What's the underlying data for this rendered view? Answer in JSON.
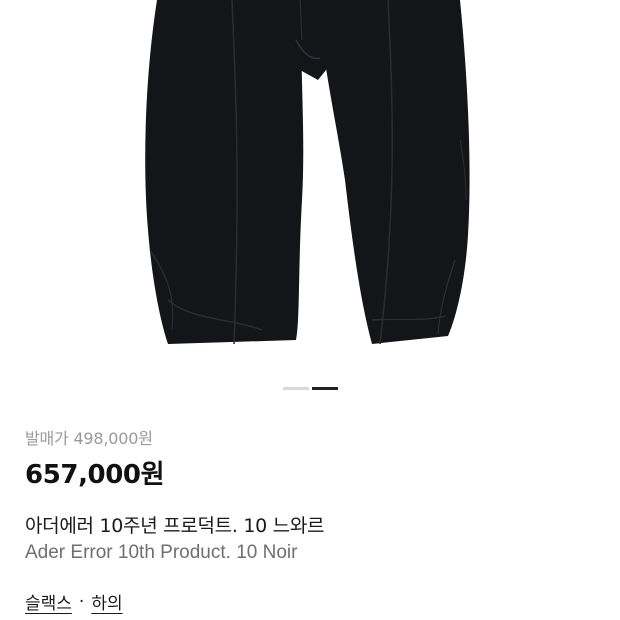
{
  "product": {
    "image_alt": "black pleated trousers",
    "carousel": {
      "count": 2,
      "active_index": 1
    },
    "release_price": "발매가 498,000원",
    "price": "657,000원",
    "name_ko": "아더에러 10주년 프로덕트. 10 느와르",
    "name_en": "Ader Error 10th Product. 10 Noir",
    "categories": [
      "슬랙스",
      "하의"
    ],
    "category_separator": "·"
  },
  "colors": {
    "garment": "#121316",
    "indicator_active": "#222222",
    "indicator_inactive": "#d9d9d9"
  }
}
